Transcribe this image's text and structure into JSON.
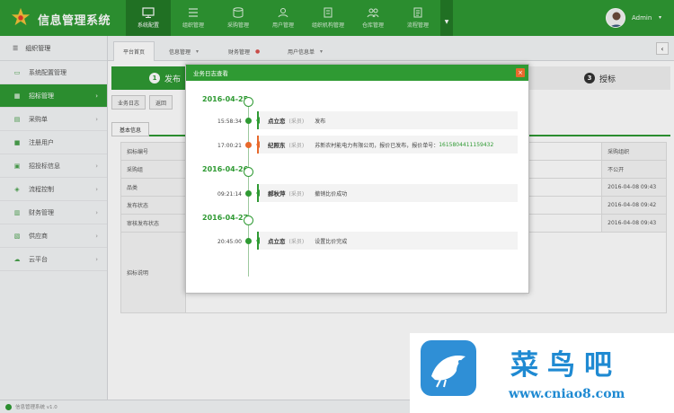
{
  "app": {
    "title": "信息管理系统",
    "user": "Admin"
  },
  "nav": [
    {
      "label": "系统配置",
      "icon": "monitor-icon"
    },
    {
      "label": "组织管理",
      "icon": "list-icon"
    },
    {
      "label": "采购管理",
      "icon": "database-icon"
    },
    {
      "label": "用户管理",
      "icon": "user-icon"
    },
    {
      "label": "组织机构管理",
      "icon": "building-icon"
    },
    {
      "label": "仓库管理",
      "icon": "people-icon"
    },
    {
      "label": "流程管理",
      "icon": "document-icon"
    }
  ],
  "sidebar": {
    "header": "组织管理",
    "items": [
      {
        "label": "系统配置管理",
        "icon": "monitor-icon"
      },
      {
        "label": "招标管理",
        "icon": "grid-icon",
        "active": true
      },
      {
        "label": "采购单",
        "icon": "cart-icon"
      },
      {
        "label": "注册用户",
        "icon": "user-icon"
      },
      {
        "label": "招投标信息",
        "icon": "list-icon"
      },
      {
        "label": "流程控制",
        "icon": "flow-icon"
      },
      {
        "label": "财务管理",
        "icon": "money-icon"
      },
      {
        "label": "供应商",
        "icon": "truck-icon"
      },
      {
        "label": "云平台",
        "icon": "cloud-icon"
      }
    ],
    "footer": "信息管理系统 v1.0"
  },
  "tabs": [
    {
      "label": "平台首页"
    },
    {
      "label": "信息管理"
    },
    {
      "label": "财务管理"
    },
    {
      "label": "用户信息单"
    }
  ],
  "page": {
    "step1": {
      "num": "1",
      "label": "发布"
    },
    "step3": {
      "num": "3",
      "label": "授标"
    },
    "toolbar": [
      "业务日志",
      "返回"
    ],
    "subtab": "基本信息",
    "form": [
      {
        "label": "招标编号",
        "right_label": "采购组织",
        "right_value": ""
      },
      {
        "label": "采购组",
        "right_label": "不公开",
        "right_value": ""
      },
      {
        "label": "品类",
        "right_label": "2016-04-08 09:43",
        "right_value": ""
      },
      {
        "label": "发布状态",
        "right_label": "2016-04-08 09:42",
        "right_value": ""
      },
      {
        "label": "审核发布状态",
        "right_label": "2016-04-08 09:43",
        "right_value": ""
      }
    ],
    "desc_label": "招标说明"
  },
  "modal": {
    "title": "业务日志查看",
    "groups": [
      {
        "date": "2016-04-25",
        "entries": [
          {
            "time": "15:58:34",
            "name": "点立恋",
            "role": "(采员)",
            "text": "发布",
            "link": "",
            "color": "green"
          },
          {
            "time": "17:00:21",
            "name": "纪照东",
            "role": "(采员)",
            "text": "苏新农村能电力有限公司，报价已发布，报价单号：",
            "link": "1615804411159432",
            "color": "red"
          }
        ]
      },
      {
        "date": "2016-04-26",
        "entries": [
          {
            "time": "09:21:14",
            "name": "郝秋萍",
            "role": "(采员)",
            "text": "撤销比价成功",
            "link": "",
            "color": "green"
          }
        ]
      },
      {
        "date": "2016-04-27",
        "entries": [
          {
            "time": "20:45:00",
            "name": "点立恋",
            "role": "(采员)",
            "text": "设置比价完成",
            "link": "",
            "color": "green"
          }
        ]
      }
    ]
  },
  "banner": {
    "title": "菜鸟吧",
    "url": "www.cniao8.com"
  },
  "colors": {
    "primary": "#2f9a33",
    "accent": "#e8692c",
    "brand": "#1f8ad2"
  }
}
